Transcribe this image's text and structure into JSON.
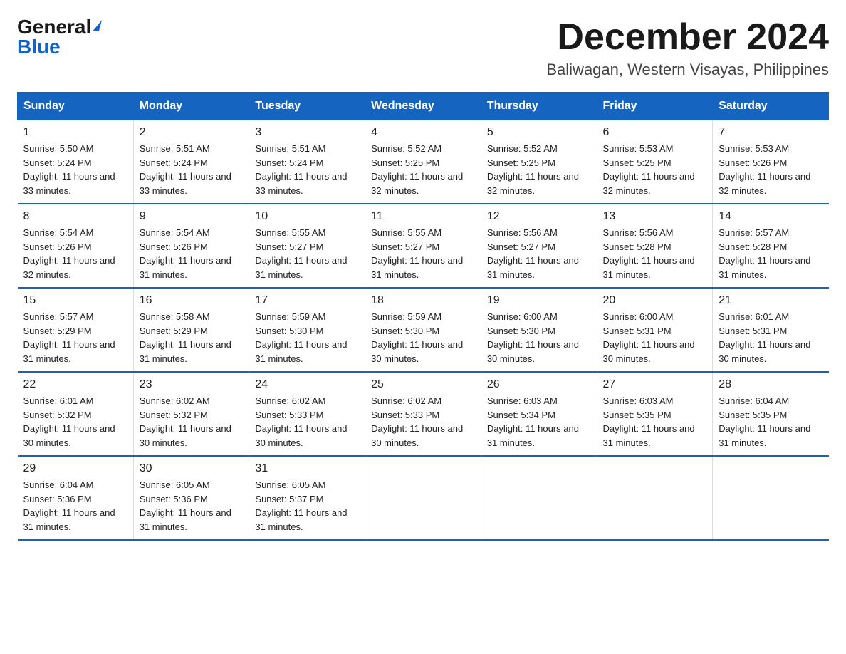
{
  "logo": {
    "general": "General",
    "blue": "Blue"
  },
  "title": {
    "month_year": "December 2024",
    "location": "Baliwagan, Western Visayas, Philippines"
  },
  "weekdays": [
    "Sunday",
    "Monday",
    "Tuesday",
    "Wednesday",
    "Thursday",
    "Friday",
    "Saturday"
  ],
  "weeks": [
    [
      {
        "day": "1",
        "sunrise": "5:50 AM",
        "sunset": "5:24 PM",
        "daylight": "11 hours and 33 minutes."
      },
      {
        "day": "2",
        "sunrise": "5:51 AM",
        "sunset": "5:24 PM",
        "daylight": "11 hours and 33 minutes."
      },
      {
        "day": "3",
        "sunrise": "5:51 AM",
        "sunset": "5:24 PM",
        "daylight": "11 hours and 33 minutes."
      },
      {
        "day": "4",
        "sunrise": "5:52 AM",
        "sunset": "5:25 PM",
        "daylight": "11 hours and 32 minutes."
      },
      {
        "day": "5",
        "sunrise": "5:52 AM",
        "sunset": "5:25 PM",
        "daylight": "11 hours and 32 minutes."
      },
      {
        "day": "6",
        "sunrise": "5:53 AM",
        "sunset": "5:25 PM",
        "daylight": "11 hours and 32 minutes."
      },
      {
        "day": "7",
        "sunrise": "5:53 AM",
        "sunset": "5:26 PM",
        "daylight": "11 hours and 32 minutes."
      }
    ],
    [
      {
        "day": "8",
        "sunrise": "5:54 AM",
        "sunset": "5:26 PM",
        "daylight": "11 hours and 32 minutes."
      },
      {
        "day": "9",
        "sunrise": "5:54 AM",
        "sunset": "5:26 PM",
        "daylight": "11 hours and 31 minutes."
      },
      {
        "day": "10",
        "sunrise": "5:55 AM",
        "sunset": "5:27 PM",
        "daylight": "11 hours and 31 minutes."
      },
      {
        "day": "11",
        "sunrise": "5:55 AM",
        "sunset": "5:27 PM",
        "daylight": "11 hours and 31 minutes."
      },
      {
        "day": "12",
        "sunrise": "5:56 AM",
        "sunset": "5:27 PM",
        "daylight": "11 hours and 31 minutes."
      },
      {
        "day": "13",
        "sunrise": "5:56 AM",
        "sunset": "5:28 PM",
        "daylight": "11 hours and 31 minutes."
      },
      {
        "day": "14",
        "sunrise": "5:57 AM",
        "sunset": "5:28 PM",
        "daylight": "11 hours and 31 minutes."
      }
    ],
    [
      {
        "day": "15",
        "sunrise": "5:57 AM",
        "sunset": "5:29 PM",
        "daylight": "11 hours and 31 minutes."
      },
      {
        "day": "16",
        "sunrise": "5:58 AM",
        "sunset": "5:29 PM",
        "daylight": "11 hours and 31 minutes."
      },
      {
        "day": "17",
        "sunrise": "5:59 AM",
        "sunset": "5:30 PM",
        "daylight": "11 hours and 31 minutes."
      },
      {
        "day": "18",
        "sunrise": "5:59 AM",
        "sunset": "5:30 PM",
        "daylight": "11 hours and 30 minutes."
      },
      {
        "day": "19",
        "sunrise": "6:00 AM",
        "sunset": "5:30 PM",
        "daylight": "11 hours and 30 minutes."
      },
      {
        "day": "20",
        "sunrise": "6:00 AM",
        "sunset": "5:31 PM",
        "daylight": "11 hours and 30 minutes."
      },
      {
        "day": "21",
        "sunrise": "6:01 AM",
        "sunset": "5:31 PM",
        "daylight": "11 hours and 30 minutes."
      }
    ],
    [
      {
        "day": "22",
        "sunrise": "6:01 AM",
        "sunset": "5:32 PM",
        "daylight": "11 hours and 30 minutes."
      },
      {
        "day": "23",
        "sunrise": "6:02 AM",
        "sunset": "5:32 PM",
        "daylight": "11 hours and 30 minutes."
      },
      {
        "day": "24",
        "sunrise": "6:02 AM",
        "sunset": "5:33 PM",
        "daylight": "11 hours and 30 minutes."
      },
      {
        "day": "25",
        "sunrise": "6:02 AM",
        "sunset": "5:33 PM",
        "daylight": "11 hours and 30 minutes."
      },
      {
        "day": "26",
        "sunrise": "6:03 AM",
        "sunset": "5:34 PM",
        "daylight": "11 hours and 31 minutes."
      },
      {
        "day": "27",
        "sunrise": "6:03 AM",
        "sunset": "5:35 PM",
        "daylight": "11 hours and 31 minutes."
      },
      {
        "day": "28",
        "sunrise": "6:04 AM",
        "sunset": "5:35 PM",
        "daylight": "11 hours and 31 minutes."
      }
    ],
    [
      {
        "day": "29",
        "sunrise": "6:04 AM",
        "sunset": "5:36 PM",
        "daylight": "11 hours and 31 minutes."
      },
      {
        "day": "30",
        "sunrise": "6:05 AM",
        "sunset": "5:36 PM",
        "daylight": "11 hours and 31 minutes."
      },
      {
        "day": "31",
        "sunrise": "6:05 AM",
        "sunset": "5:37 PM",
        "daylight": "11 hours and 31 minutes."
      },
      null,
      null,
      null,
      null
    ]
  ]
}
